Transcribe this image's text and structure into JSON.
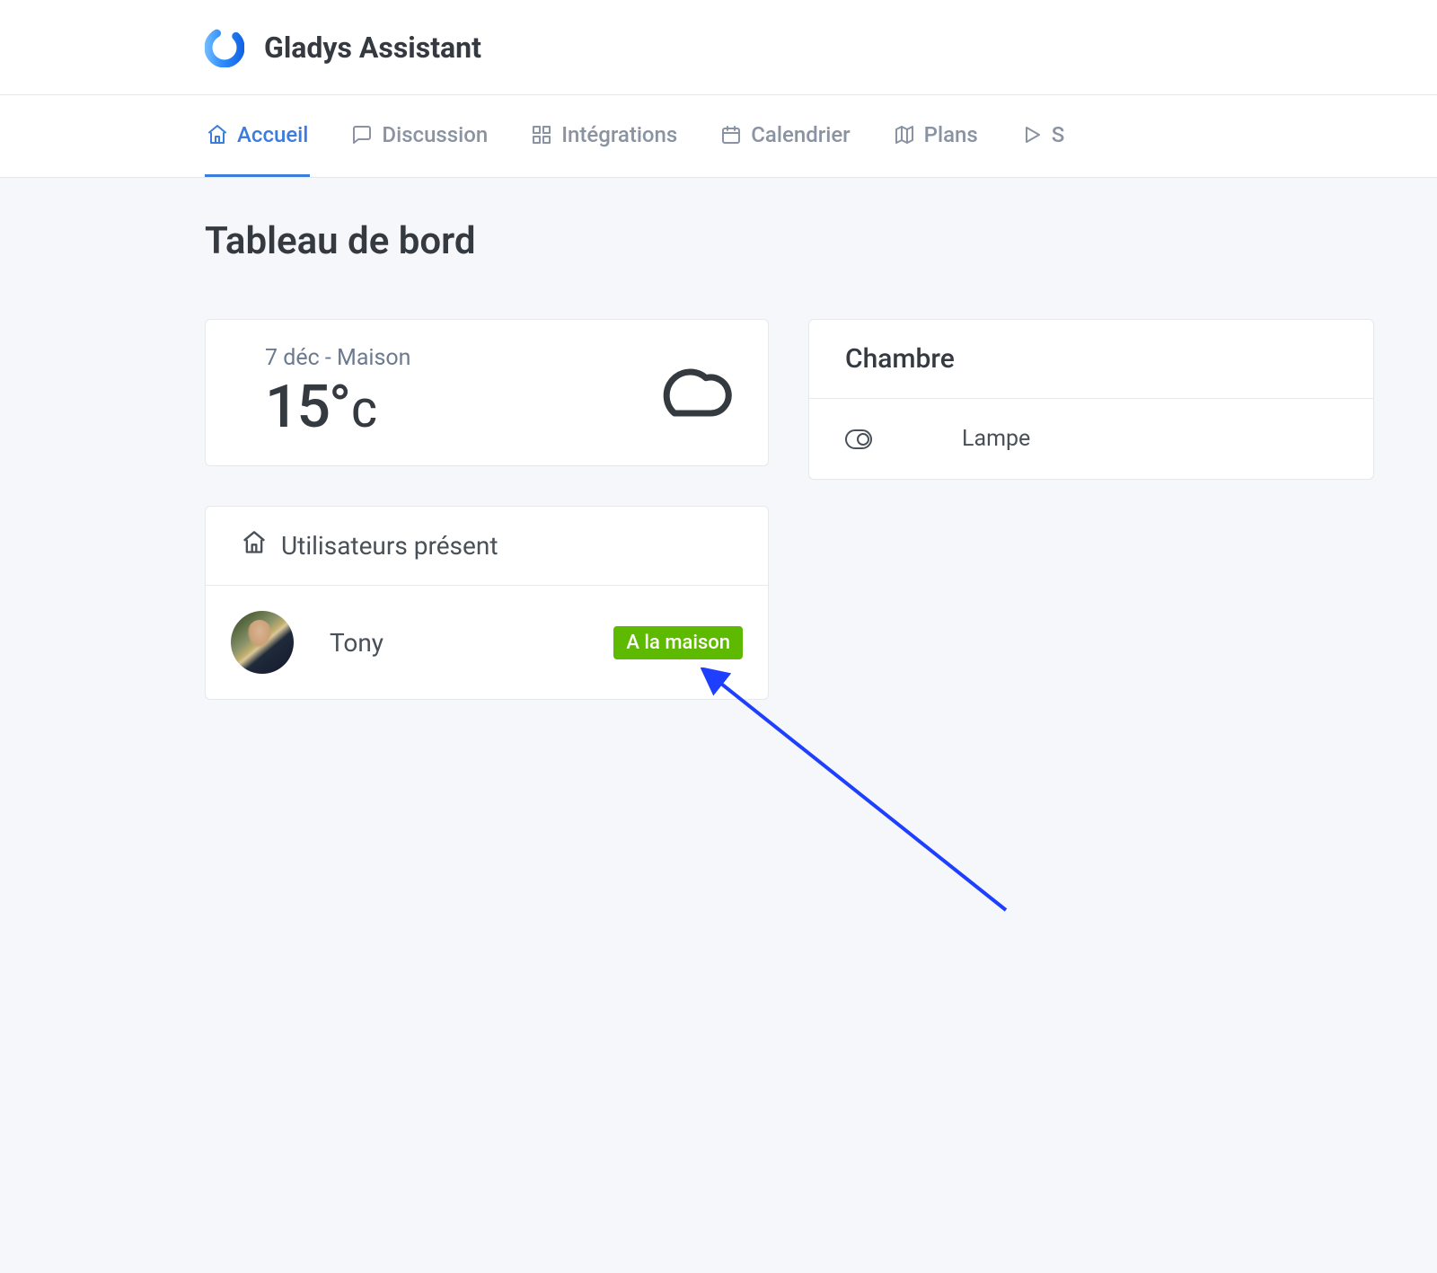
{
  "brand": {
    "name": "Gladys Assistant"
  },
  "nav": {
    "items": [
      {
        "label": "Accueil"
      },
      {
        "label": "Discussion"
      },
      {
        "label": "Intégrations"
      },
      {
        "label": "Calendrier"
      },
      {
        "label": "Plans"
      },
      {
        "label": "S"
      }
    ]
  },
  "page": {
    "title": "Tableau de bord"
  },
  "weather": {
    "date_location": "7 déc - Maison",
    "temp_value": "15°",
    "temp_unit": "C"
  },
  "users_card": {
    "title": "Utilisateurs présent"
  },
  "user": {
    "name": "Tony",
    "status": "A la maison"
  },
  "room": {
    "title": "Chambre",
    "device_label": "Lampe"
  },
  "colors": {
    "accent": "#3b7ddd",
    "success": "#5eba00",
    "text_muted": "#8a93a2",
    "text": "#343a40",
    "bg": "#f5f7fb"
  }
}
